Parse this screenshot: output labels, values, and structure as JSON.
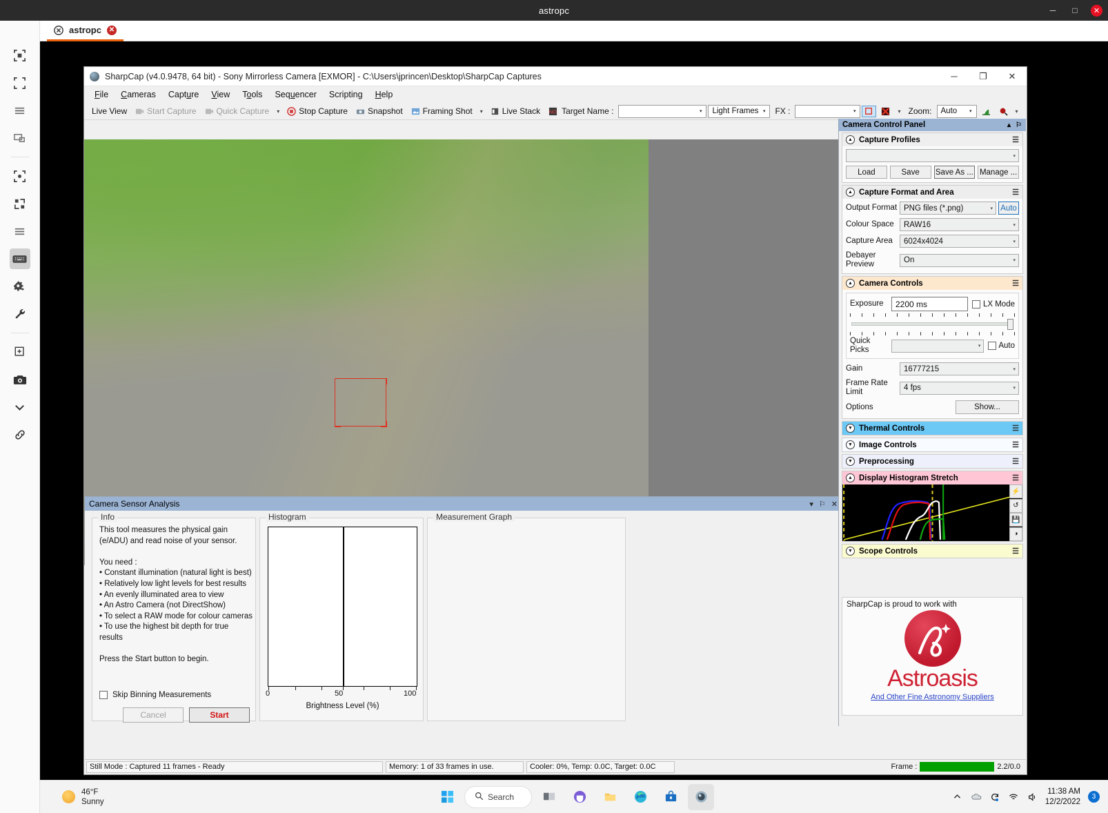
{
  "remote": {
    "title": "astropc",
    "minimize": "─",
    "maximize": "□",
    "close": "✕",
    "tab_label": "astropc",
    "tab_close": "✕",
    "rail_items": [
      {
        "name": "fit-to-window-icon"
      },
      {
        "name": "fullscreen-icon"
      },
      {
        "name": "menu-icon"
      },
      {
        "name": "multi-monitor-icon"
      },
      {
        "name": "scale-icon"
      },
      {
        "name": "expand-icon"
      },
      {
        "name": "list-icon"
      },
      {
        "name": "keyboard-icon"
      },
      {
        "name": "settings-gear-icon"
      },
      {
        "name": "wrench-icon"
      },
      {
        "name": "add-window-icon"
      },
      {
        "name": "camera-icon"
      },
      {
        "name": "chevron-down-icon"
      },
      {
        "name": "link-icon"
      }
    ]
  },
  "sharpcap": {
    "title": "SharpCap (v4.0.9478, 64 bit) - Sony Mirrorless Camera [EXMOR] - C:\\Users\\jprincen\\Desktop\\SharpCap Captures",
    "window_buttons": {
      "minimize": "─",
      "restore": "❐",
      "close": "✕"
    },
    "menu": [
      "File",
      "Cameras",
      "Capture",
      "View",
      "Tools",
      "Sequencer",
      "Scripting",
      "Help"
    ],
    "toolbar": {
      "live_view": "Live View",
      "start_capture": "Start Capture",
      "quick_capture": "Quick Capture",
      "quick_capture_caret": "▾",
      "stop_capture": "Stop Capture",
      "snapshot": "Snapshot",
      "framing_shot": "Framing Shot",
      "framing_shot_caret": "▾",
      "live_stack": "Live Stack",
      "target_name_label": "Target Name :",
      "target_name_value": "",
      "frame_type": "Light Frames",
      "fx_label": "FX :",
      "fx_value": "",
      "extra_caret": "▾",
      "zoom_label": "Zoom:",
      "zoom_value": "Auto",
      "histogram_tool_caret": "▾"
    },
    "status_bar": {
      "mode": "Still Mode : Captured 11 frames - Ready",
      "memory": "Memory: 1 of 33 frames in use.",
      "cooler": "Cooler: 0%, Temp: 0.0C, Target: 0.0C",
      "frame_label": "Frame :",
      "frame_value": "2.2/0.0",
      "frame_progress_pct": 100
    }
  },
  "sensor_analysis": {
    "panel_title": "Camera Sensor Analysis",
    "panel_buttons": {
      "collapse": "▾",
      "pin": "⚐",
      "close": "✕"
    },
    "info_legend": "Info",
    "info_text": "This tool measures the physical gain (e/ADU) and read noise of your sensor.\n\nYou need :\n• Constant illumination (natural light is best)\n• Relatively low light levels for best results\n• An evenly illuminated area to view\n• An Astro Camera (not DirectShow)\n• To select a RAW mode for colour cameras\n• To use the highest bit depth for true results\n\nPress the Start button to begin.",
    "skip_binning_label": "Skip Binning Measurements",
    "cancel_label": "Cancel",
    "start_label": "Start",
    "histogram_legend": "Histogram",
    "measurement_legend": "Measurement Graph"
  },
  "chart_data": {
    "type": "bar",
    "title": "Histogram",
    "xlabel": "Brightness Level (%)",
    "ylabel": "",
    "categories": [],
    "values": [],
    "xticklabels": [
      "0",
      "50",
      "100"
    ],
    "xlim": [
      0,
      100
    ],
    "grid": false,
    "notes": "Empty histogram plot; only a vertical marker line at 50% brightness is drawn."
  },
  "camera_control_panel": {
    "title": "Camera Control Panel",
    "header_buttons": {
      "collapse": "▴",
      "pin": "⚐"
    },
    "sections": {
      "capture_profiles": {
        "title": "Capture Profiles",
        "profile_value": "",
        "buttons": [
          "Load",
          "Save",
          "Save As ...",
          "Manage ..."
        ]
      },
      "capture_format": {
        "title": "Capture Format and Area",
        "rows": [
          {
            "label": "Output Format",
            "value": "PNG files (*.png)"
          },
          {
            "label": "Colour Space",
            "value": "RAW16"
          },
          {
            "label": "Capture Area",
            "value": "6024x4024"
          },
          {
            "label": "Debayer Preview",
            "value": "On"
          }
        ],
        "auto_button": "Auto"
      },
      "camera_controls": {
        "title": "Camera Controls",
        "exposure_label": "Exposure",
        "exposure_value": "2200 ms",
        "lx_mode_label": "LX Mode",
        "quick_picks_label": "Quick Picks",
        "quick_picks_value": "",
        "auto_label": "Auto",
        "gain_label": "Gain",
        "gain_value": "16777215",
        "frame_rate_label": "Frame Rate Limit",
        "frame_rate_value": "4 fps",
        "options_label": "Options",
        "show_label": "Show..."
      },
      "thermal_controls": {
        "title": "Thermal Controls"
      },
      "image_controls": {
        "title": "Image Controls"
      },
      "preprocessing": {
        "title": "Preprocessing"
      },
      "display_histogram_stretch": {
        "title": "Display Histogram Stretch",
        "tools": [
          "⚡",
          "↺",
          "💾",
          "◑"
        ]
      },
      "scope_controls": {
        "title": "Scope Controls"
      }
    },
    "sponsor": {
      "line": "SharpCap is proud to work with",
      "brand": "Astroasis",
      "link": "And Other Fine Astronomy Suppliers"
    }
  },
  "taskbar": {
    "weather_temp": "46°F",
    "weather_desc": "Sunny",
    "search_label": "Search",
    "apps": [
      "start-button",
      "search-box",
      "task-view",
      "teams",
      "file-explorer",
      "edge",
      "store",
      "sharpcap"
    ],
    "clock_time": "11:38 AM",
    "clock_date": "12/2/2022",
    "notification_count": "3"
  },
  "colors": {
    "accent_orange": "#e8600c",
    "close_red": "#e81123",
    "panel_blue": "#9bb4d4",
    "thermal_blue": "#6cc8f5",
    "hist_pink": "#ffc6d6",
    "scope_yellow": "#fbfbd0",
    "camctl_peach": "#fde8ce",
    "start_red": "#d41414",
    "progress_green": "#00a000",
    "brand_red": "#cf2133"
  }
}
